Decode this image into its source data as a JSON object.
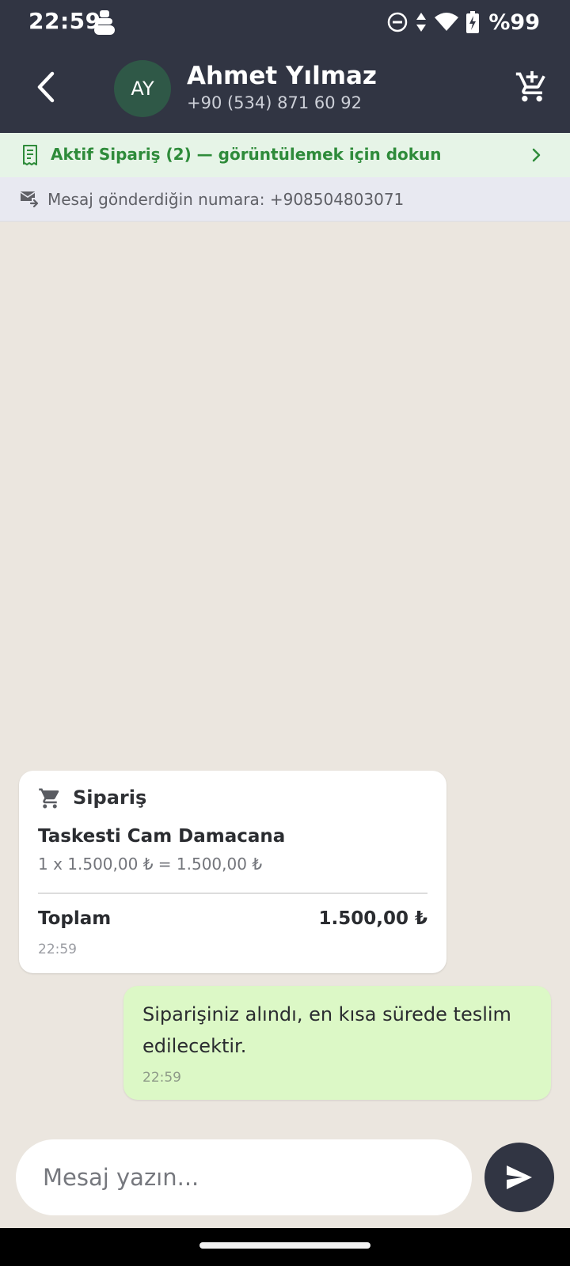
{
  "status_bar": {
    "time": "22:59",
    "battery": "%99",
    "icons": [
      "notification-icon",
      "dnd-icon",
      "data-arrows-icon",
      "wifi-icon",
      "battery-charging-icon"
    ]
  },
  "header": {
    "avatar_initials": "AY",
    "name": "Ahmet Yılmaz",
    "phone": "+90 (534) 871 60 92",
    "icons": [
      "back-arrow-icon",
      "add-to-cart-icon"
    ]
  },
  "active_order_banner": {
    "text": "Aktif Sipariş (2) — görüntülemek için dokun",
    "color": "#2e8b3a",
    "icons": [
      "receipt-icon",
      "chevron-right-icon"
    ]
  },
  "sender_info": {
    "text": "Mesaj gönderdiğin numara: +908504803071",
    "icon": "mail-forward-icon"
  },
  "messages": {
    "order": {
      "title": "Sipariş",
      "product_name": "Taskesti Cam Damacana",
      "product_line": "1 x 1.500,00 ₺ = 1.500,00 ₺",
      "total_label": "Toplam",
      "total_value": "1.500,00 ₺",
      "time": "22:59",
      "icon": "shopping-cart-icon"
    },
    "reply": {
      "text": "Siparişiniz alındı, en kısa sürede teslim edilecektir.",
      "time": "22:59"
    }
  },
  "composer": {
    "placeholder": "Mesaj yazın...",
    "send_icon": "send-icon"
  },
  "colors": {
    "header_bg": "#313543",
    "chat_bg": "#ebe6df",
    "outgoing_bubble": "#dcf8c6",
    "banner_bg": "#e6f4e7"
  }
}
